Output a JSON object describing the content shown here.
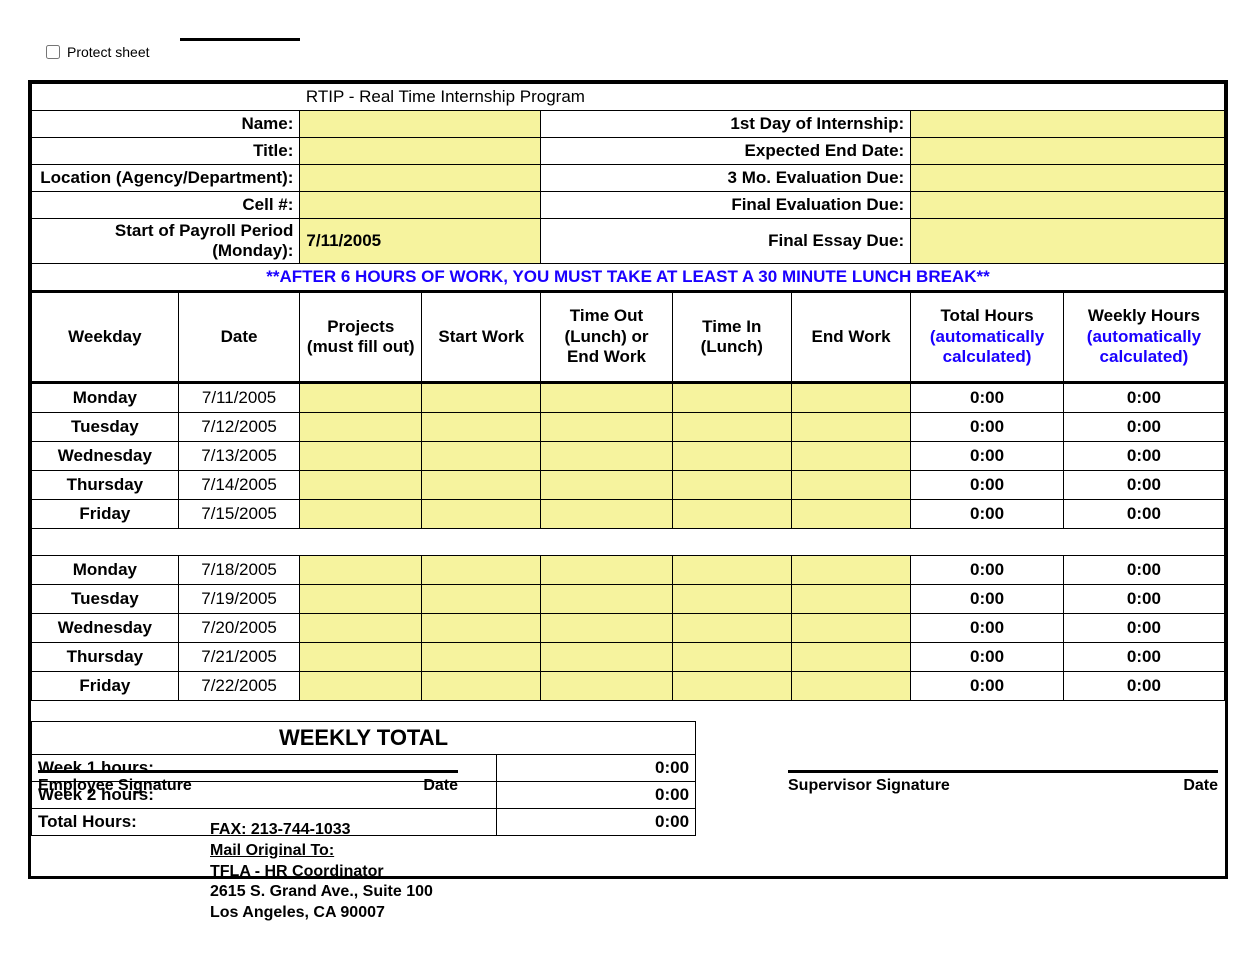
{
  "protect_label": "Protect sheet",
  "title": "RTIP - Real Time Internship Program",
  "labels_left": {
    "name": "Name:",
    "title": "Title:",
    "location": "Location (Agency/Department):",
    "cell": "Cell #:",
    "payroll_start": "Start of Payroll Period (Monday):"
  },
  "labels_right": {
    "first_day": "1st Day of Internship:",
    "expected_end": "Expected End Date:",
    "eval3": "3 Mo. Evaluation Due:",
    "final_eval": "Final Evaluation Due:",
    "final_essay": "Final Essay Due:"
  },
  "values": {
    "payroll_start": "7/11/2005"
  },
  "notice": "**AFTER 6 HOURS OF WORK, YOU MUST TAKE AT LEAST A 30 MINUTE LUNCH BREAK**",
  "columns": {
    "weekday": "Weekday",
    "date": "Date",
    "projects": "Projects (must fill out)",
    "start": "Start Work",
    "timeout": "Time Out (Lunch) or End Work",
    "timein": "Time In (Lunch)",
    "end": "End Work",
    "total_h": "Total Hours",
    "total_note": "(automatically calculated)",
    "weekly_h": "Weekly Hours",
    "weekly_note": "(automatically calculated)"
  },
  "week1": [
    {
      "wd": "Monday",
      "dt": "7/11/2005",
      "tot": "0:00",
      "wk": "0:00"
    },
    {
      "wd": "Tuesday",
      "dt": "7/12/2005",
      "tot": "0:00",
      "wk": "0:00"
    },
    {
      "wd": "Wednesday",
      "dt": "7/13/2005",
      "tot": "0:00",
      "wk": "0:00"
    },
    {
      "wd": "Thursday",
      "dt": "7/14/2005",
      "tot": "0:00",
      "wk": "0:00"
    },
    {
      "wd": "Friday",
      "dt": "7/15/2005",
      "tot": "0:00",
      "wk": "0:00"
    }
  ],
  "week2": [
    {
      "wd": "Monday",
      "dt": "7/18/2005",
      "tot": "0:00",
      "wk": "0:00"
    },
    {
      "wd": "Tuesday",
      "dt": "7/19/2005",
      "tot": "0:00",
      "wk": "0:00"
    },
    {
      "wd": "Wednesday",
      "dt": "7/20/2005",
      "tot": "0:00",
      "wk": "0:00"
    },
    {
      "wd": "Thursday",
      "dt": "7/21/2005",
      "tot": "0:00",
      "wk": "0:00"
    },
    {
      "wd": "Friday",
      "dt": "7/22/2005",
      "tot": "0:00",
      "wk": "0:00"
    }
  ],
  "totals": {
    "title": "WEEKLY TOTAL",
    "w1_lbl": "Week 1 hours:",
    "w1_val": "0:00",
    "w2_lbl": "Week 2 hours:",
    "w2_val": "0:00",
    "t_lbl": "Total Hours:",
    "t_val": "0:00"
  },
  "sig": {
    "emp": "Employee Signature",
    "sup": "Supervisor Signature",
    "date": "Date"
  },
  "mail": {
    "fax": "FAX:  213-744-1033",
    "l1": "Mail Original To:",
    "l2": "TFLA - HR Coordinator",
    "l3": "2615 S. Grand Ave., Suite 100",
    "l4": "Los Angeles, CA 90007"
  }
}
